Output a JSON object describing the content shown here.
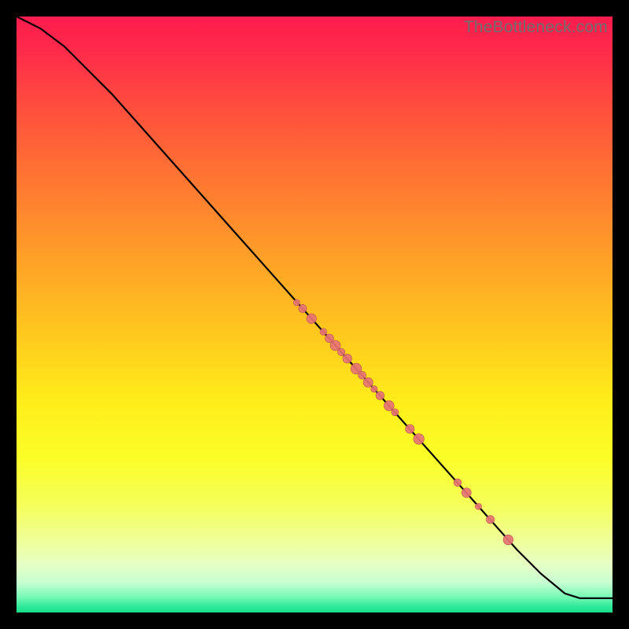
{
  "watermark": "TheBottleneck.com",
  "chart_data": {
    "type": "line",
    "title": "",
    "xlabel": "",
    "ylabel": "",
    "xlim": [
      0,
      100
    ],
    "ylim": [
      0,
      100
    ],
    "line": {
      "x": [
        0,
        4,
        8,
        12,
        16,
        20,
        24,
        28,
        32,
        36,
        40,
        44,
        48,
        52,
        56,
        60,
        64,
        68,
        72,
        76,
        80,
        84,
        88,
        92,
        94.5,
        100
      ],
      "y": [
        100,
        98,
        95,
        91,
        87,
        82.5,
        78,
        73.5,
        69,
        64.5,
        60,
        55.5,
        51,
        46.5,
        42,
        37.5,
        33,
        28.5,
        24,
        19.5,
        15,
        10.5,
        6.5,
        3.2,
        2.4,
        2.4
      ]
    },
    "scatter": {
      "x": [
        47,
        48,
        49.5,
        51.5,
        52.5,
        53.5,
        54.5,
        55.5,
        57,
        58,
        59,
        60,
        61,
        62.5,
        63.5,
        66,
        67.5,
        74,
        75.5,
        77.5,
        79.5,
        82.5
      ],
      "y": [
        52,
        51,
        49.3,
        47.1,
        46.0,
        44.8,
        43.7,
        42.6,
        40.9,
        39.8,
        38.6,
        37.5,
        36.4,
        34.7,
        33.6,
        30.8,
        29.1,
        21.8,
        20.1,
        17.8,
        15.6,
        12.2
      ]
    },
    "gradient_stops": [
      {
        "offset": 0.0,
        "color": "#ff1c4e"
      },
      {
        "offset": 0.06,
        "color": "#ff2b4a"
      },
      {
        "offset": 0.15,
        "color": "#ff4d3e"
      },
      {
        "offset": 0.25,
        "color": "#ff6e34"
      },
      {
        "offset": 0.35,
        "color": "#ff8e2c"
      },
      {
        "offset": 0.45,
        "color": "#ffae24"
      },
      {
        "offset": 0.55,
        "color": "#ffce1d"
      },
      {
        "offset": 0.65,
        "color": "#ffee1a"
      },
      {
        "offset": 0.74,
        "color": "#fbfd27"
      },
      {
        "offset": 0.82,
        "color": "#f5ff5a"
      },
      {
        "offset": 0.88,
        "color": "#efff9a"
      },
      {
        "offset": 0.92,
        "color": "#e6ffc5"
      },
      {
        "offset": 0.95,
        "color": "#c7ffd1"
      },
      {
        "offset": 0.975,
        "color": "#74f9b4"
      },
      {
        "offset": 0.99,
        "color": "#2ee899"
      },
      {
        "offset": 1.0,
        "color": "#17df8b"
      }
    ],
    "line_color": "#000000",
    "point_fill": "#e77473",
    "point_stroke": "#b9504f",
    "point_radius_range": [
      4,
      7
    ]
  }
}
